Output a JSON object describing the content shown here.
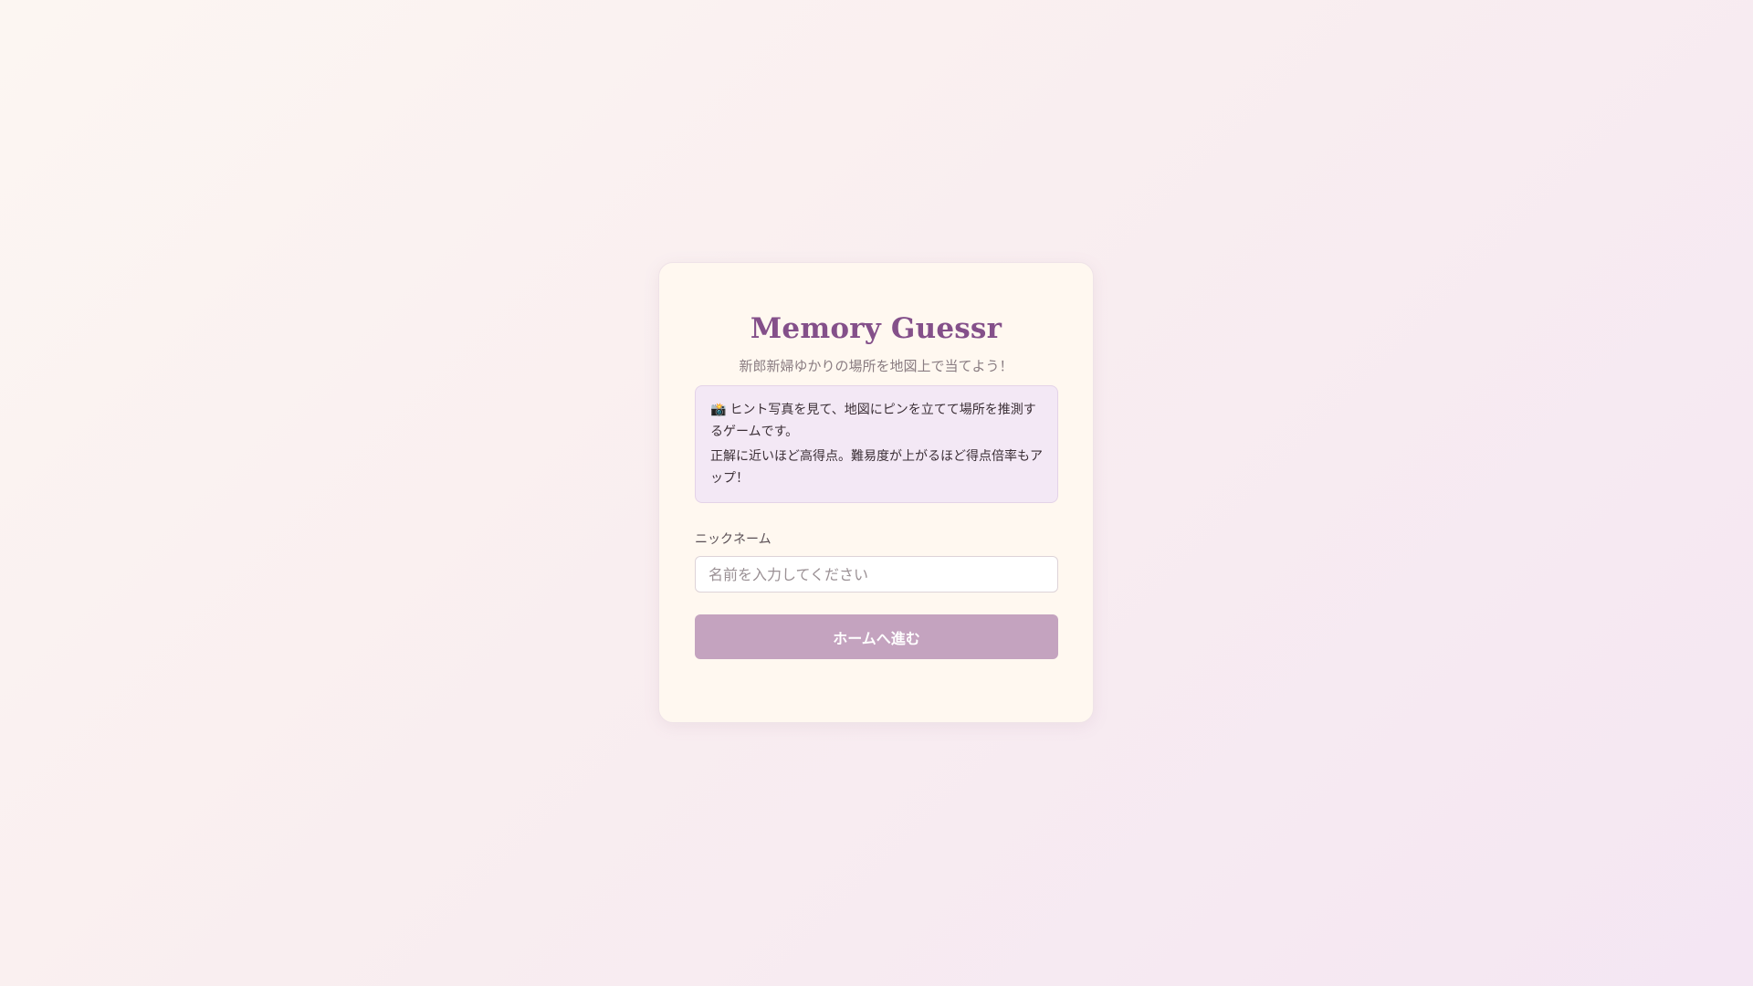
{
  "login": {
    "title": "Memory Guessr",
    "subtitle": "新郎新婦ゆかりの場所を地図上で当てよう！",
    "info": {
      "icon": "camera-icon",
      "icon_glyph": "📸",
      "line1": "ヒント写真を見て、地図にピンを立てて場所を推測するゲームです。",
      "line2": "正解に近いほど高得点。難易度が上がるほど得点倍率もアップ！"
    },
    "nickname_label": "ニックネーム",
    "nickname_value": "",
    "nickname_placeholder": "名前を入力してください",
    "submit_label": "ホームへ進む"
  },
  "colors": {
    "title": "#84508a",
    "card_background": "#fff8f0",
    "info_background": "#f3e8f5",
    "button_background": "#c4a3bf"
  }
}
